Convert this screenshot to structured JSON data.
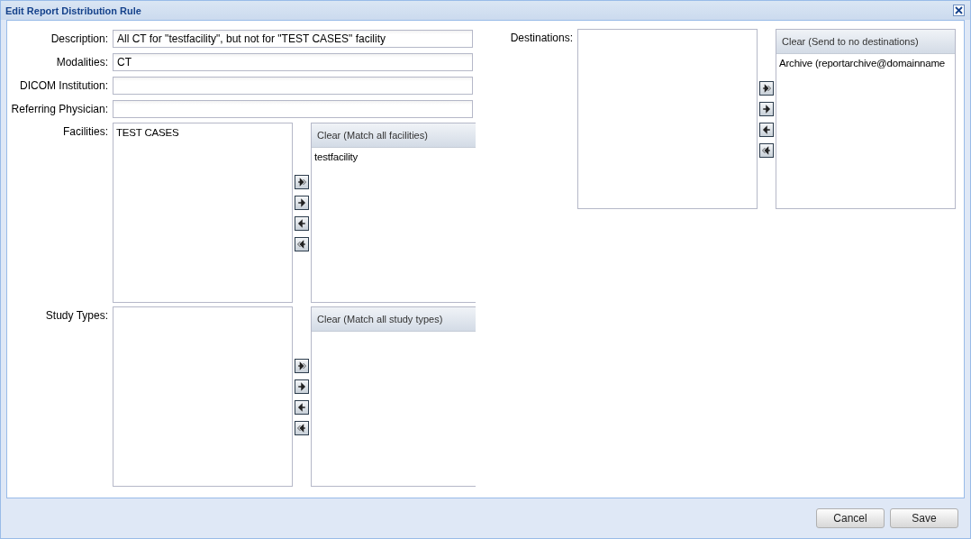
{
  "window": {
    "title": "Edit Report Distribution Rule"
  },
  "fields": [
    {
      "label": "Description:",
      "value": "All CT for \"testfacility\", but not for \"TEST CASES\" facility"
    },
    {
      "label": "Modalities:",
      "value": "CT"
    },
    {
      "label": "DICOM Institution:"
    },
    {
      "label": "Referring Physician:"
    }
  ],
  "pickers": [
    {
      "label": "Facilities:",
      "available": [
        "TEST CASES"
      ],
      "clear_button": "Clear (Match all facilities)",
      "selected_items": [
        "testfacility"
      ]
    },
    {
      "label": "Study Types:",
      "clear_button": "Clear (Match all study types)"
    }
  ],
  "destinations": {
    "label": "Destinations:",
    "clear_button": "Clear (Send to no destinations)",
    "selected_items": [
      "Archive (reportarchive@domainname"
    ]
  },
  "buttons": [
    "Cancel",
    "Save"
  ]
}
